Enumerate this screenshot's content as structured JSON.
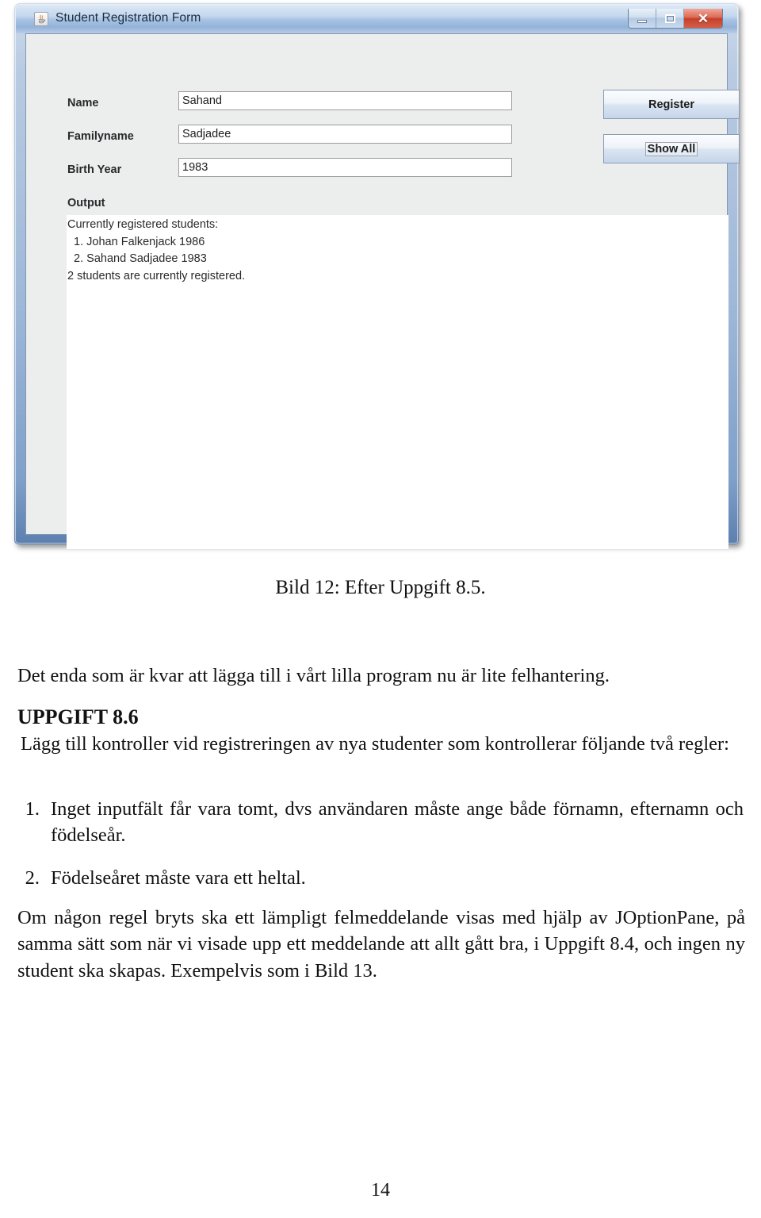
{
  "window": {
    "title": "Student Registration Form",
    "icon": "java-coffee-cup-icon",
    "controls": {
      "minimize": "minimize-icon",
      "maximize": "maximize-icon",
      "close": "✕"
    }
  },
  "form": {
    "fields": [
      {
        "label": "Name",
        "value": "Sahand"
      },
      {
        "label": "Familyname",
        "value": "Sadjadee"
      },
      {
        "label": "Birth Year",
        "value": "1983"
      }
    ],
    "buttons": [
      {
        "label": "Register",
        "focused": false
      },
      {
        "label": "Show All",
        "focused": true
      }
    ]
  },
  "output": {
    "label": "Output",
    "lines": [
      "Currently registered students:",
      "  1. Johan Falkenjack 1986",
      "  2. Sahand Sadjadee 1983",
      "2 students are currently registered."
    ]
  },
  "document": {
    "caption": "Bild 12: Efter Uppgift 8.5.",
    "intro": "Det enda som är kvar att lägga till i vårt lilla program nu är lite felhantering.",
    "task_heading": "UPPGIFT 8.6",
    "task_intro": "Lägg till kontroller vid registreringen av nya studenter som kontrollerar följande två regler:",
    "rules": [
      {
        "num": "1.",
        "text": "Inget inputfält får vara tomt, dvs användaren måste ange både förnamn, efternamn och födelseår."
      },
      {
        "num": "2.",
        "text": "Födelseåret måste vara ett heltal."
      }
    ],
    "closing": "Om någon regel bryts ska ett lämpligt felmeddelande visas med hjälp av JOptionPane, på samma sätt som när vi visade upp ett meddelande att allt gått bra, i Uppgift 8.4, och ingen ny student ska skapas. Exempelvis som i Bild 13.",
    "page_number": "14"
  },
  "colors": {
    "aero_frame": "#9fb8d8",
    "close_red": "#c3402c",
    "panel_gray": "#eceded",
    "text_white": "#ffffff"
  }
}
